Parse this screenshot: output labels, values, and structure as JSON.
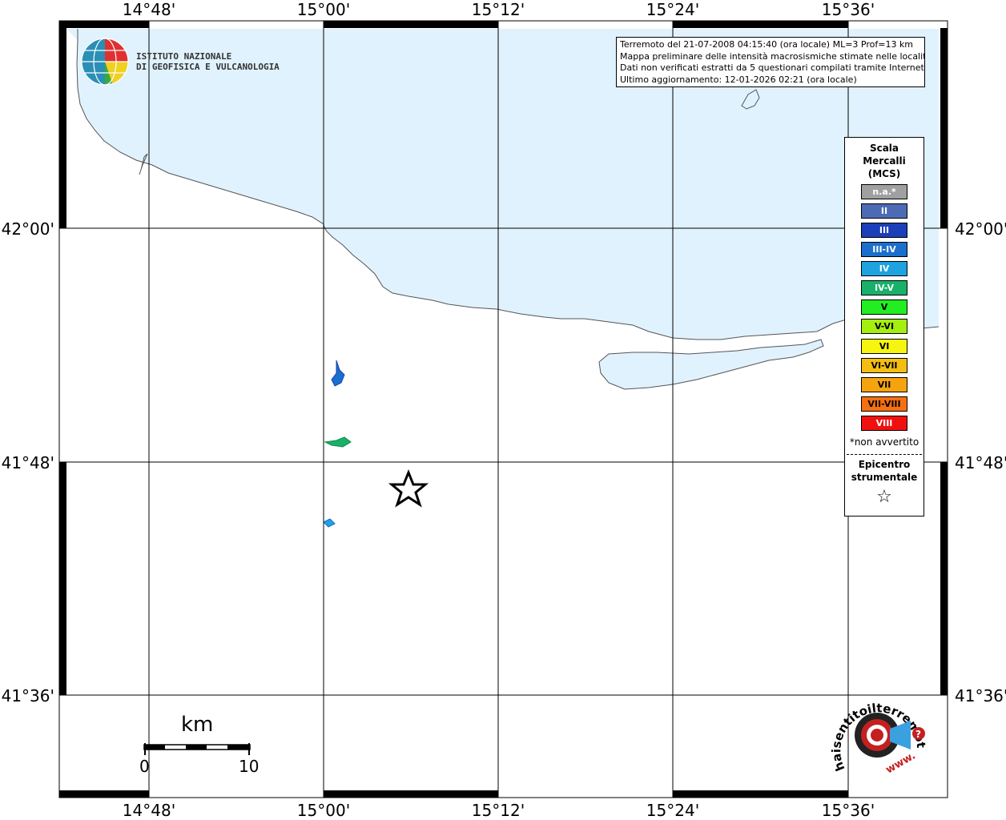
{
  "map": {
    "lon_labels": [
      "14°48'",
      "15°00'",
      "15°12'",
      "15°24'",
      "15°36'"
    ],
    "lat_labels": [
      "42°00'",
      "41°48'",
      "41°36'"
    ],
    "sea_color": "#e0f2fd",
    "land_color": "#ffffff"
  },
  "info": {
    "line1": "Terremoto del 21-07-2008 04:15:40 (ora locale) ML=3 Prof=13 km",
    "line2": "Mappa preliminare delle intensità macrosismiche stimate nelle località",
    "line3": "Dati non verificati estratti da 5 questionari compilati tramite Internet.",
    "line4": "Ultimo aggiornamento: 12-01-2026 02:21 (ora locale)"
  },
  "legend": {
    "title": "Scala\nMercalli\n(MCS)",
    "items": [
      {
        "label": "n.a.*",
        "color": "#a0a0a0"
      },
      {
        "label": "II",
        "color": "#4d6bb5"
      },
      {
        "label": "III",
        "color": "#1a3fb8"
      },
      {
        "label": "III-IV",
        "color": "#1a6ecc"
      },
      {
        "label": "IV",
        "color": "#1ea3e0"
      },
      {
        "label": "IV-V",
        "color": "#19b06a"
      },
      {
        "label": "V",
        "color": "#22ee22"
      },
      {
        "label": "V-VI",
        "color": "#a4ee10"
      },
      {
        "label": "VI",
        "color": "#f5f510"
      },
      {
        "label": "VI-VII",
        "color": "#f3be10"
      },
      {
        "label": "VII",
        "color": "#f5a410"
      },
      {
        "label": "VII-VIII",
        "color": "#f57010"
      },
      {
        "label": "VIII",
        "color": "#f01010"
      }
    ],
    "note": "*non avvertito",
    "epicenter_label": "Epicentro\nstrumentale",
    "epicenter_symbol": "☆"
  },
  "logo": {
    "text": "ISTITUTO NAZIONALE\nDI GEOFISICA E VULCANOLOGIA"
  },
  "scalebar": {
    "unit": "km",
    "start": "0",
    "end": "10"
  },
  "hsl_logo": {
    "text": "haisentitoilterremoto.it",
    "url_text": "www."
  }
}
